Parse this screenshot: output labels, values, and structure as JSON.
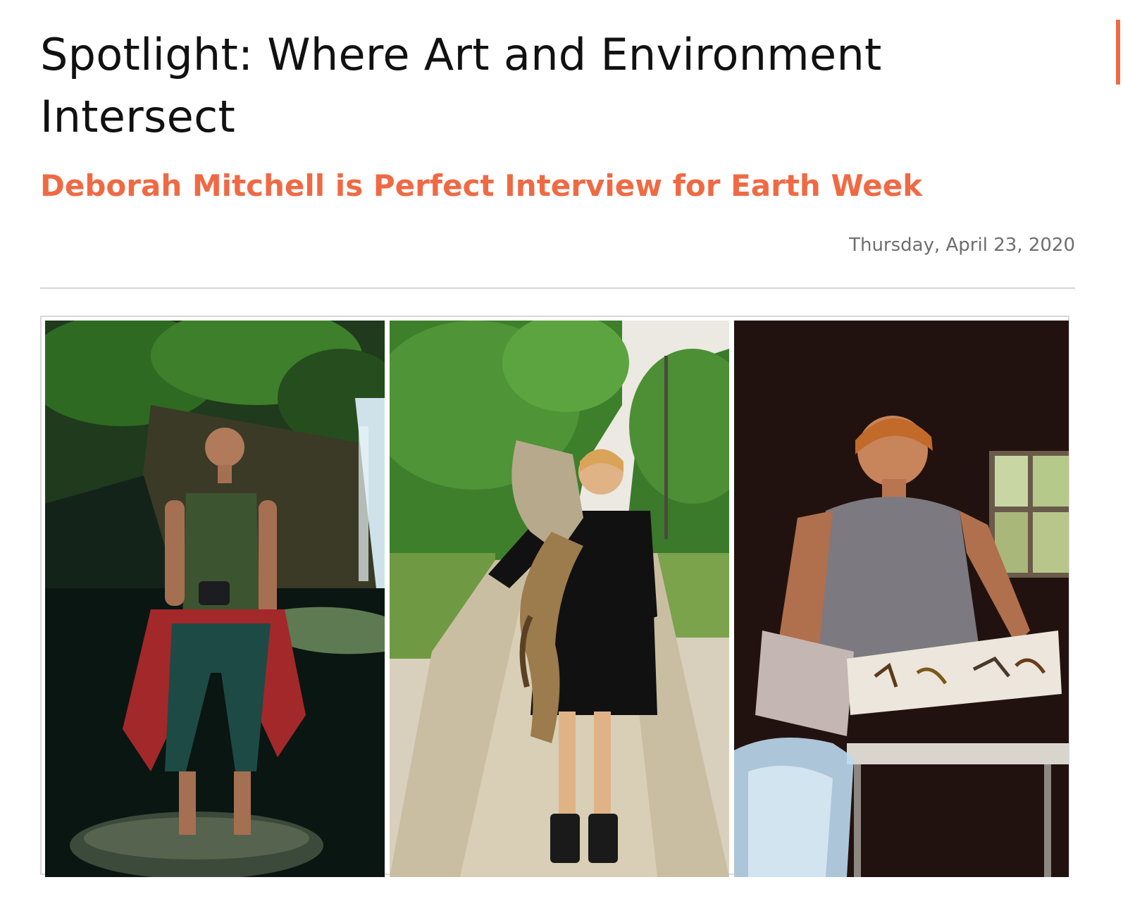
{
  "article": {
    "title": "Spotlight: Where Art and Environment Intersect",
    "subtitle": "Deborah Mitchell is Perfect Interview for Earth Week",
    "date": "Thursday, April 23, 2020"
  },
  "colors": {
    "accent": "#ef6a44",
    "title": "#111111",
    "date": "#6e6e6e",
    "divider": "#d4d4d4"
  },
  "photos": [
    {
      "name": "woman-at-waterfall-with-camera"
    },
    {
      "name": "woman-holding-snakeskin-on-dirt-road"
    },
    {
      "name": "woman-pressing-plants-in-studio"
    }
  ]
}
